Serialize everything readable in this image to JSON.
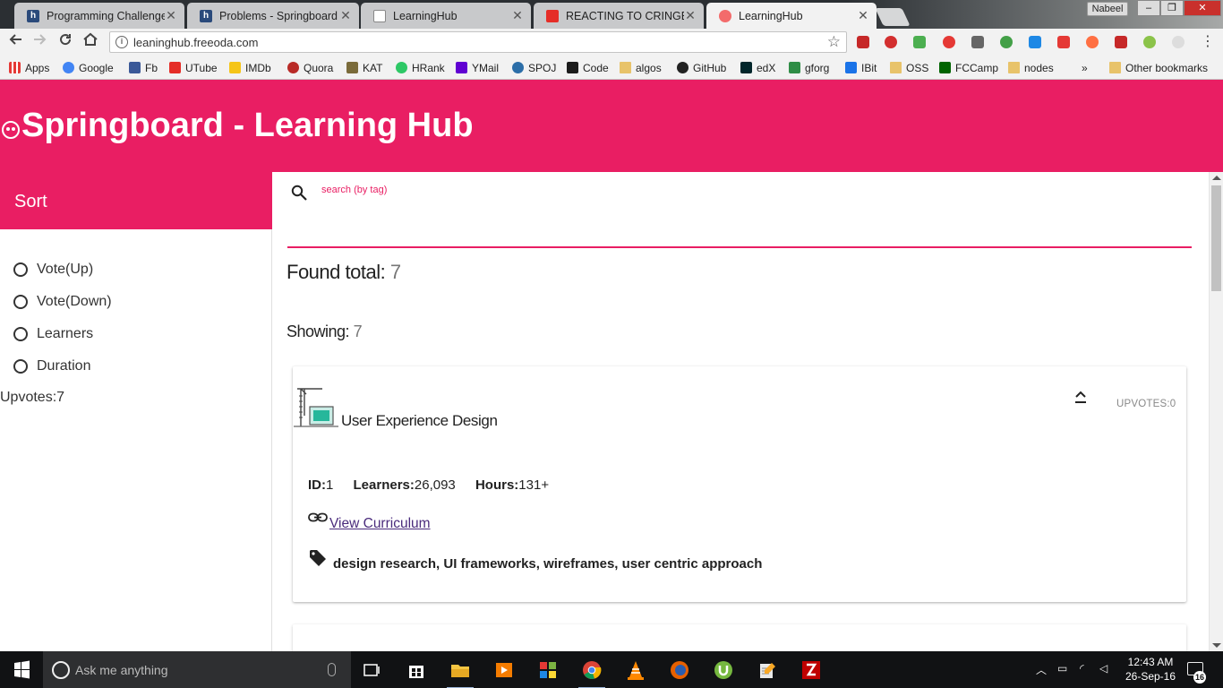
{
  "browser": {
    "tabs": [
      {
        "title": "Programming Challenge",
        "favicon": "hackerrank-icon"
      },
      {
        "title": "Problems - Springboard",
        "favicon": "hackerrank-icon"
      },
      {
        "title": "LearningHub",
        "favicon": "document-icon"
      },
      {
        "title": "REACTING TO CRINGE /v",
        "favicon": "youtube-icon"
      },
      {
        "title": "LearningHub",
        "favicon": "learninghub-icon",
        "active": true
      }
    ],
    "window_user": "Nabeel",
    "window_controls": {
      "minimize": "‒",
      "maximize": "❐",
      "close": "✕"
    },
    "address": "leaninghub.freeoda.com",
    "bookmarks": [
      {
        "label": "Apps",
        "icon": "apps-grid-icon"
      },
      {
        "label": "Google",
        "icon": "google-icon"
      },
      {
        "label": "Fb",
        "icon": "facebook-icon"
      },
      {
        "label": "UTube",
        "icon": "youtube-icon"
      },
      {
        "label": "IMDb",
        "icon": "imdb-icon"
      },
      {
        "label": "Quora",
        "icon": "quora-icon"
      },
      {
        "label": "KAT",
        "icon": "kat-icon"
      },
      {
        "label": "HRank",
        "icon": "hackerrank-icon"
      },
      {
        "label": "YMail",
        "icon": "yahoo-mail-icon"
      },
      {
        "label": "SPOJ",
        "icon": "spoj-icon"
      },
      {
        "label": "Code",
        "icon": "code-icon"
      },
      {
        "label": "algos",
        "icon": "folder-icon"
      },
      {
        "label": "GitHub",
        "icon": "github-icon"
      },
      {
        "label": "edX",
        "icon": "edx-icon"
      },
      {
        "label": "gforg",
        "icon": "geeksforgeeks-icon"
      },
      {
        "label": "IBit",
        "icon": "interviewbit-icon"
      },
      {
        "label": "OSS",
        "icon": "folder-icon"
      },
      {
        "label": "FCCamp",
        "icon": "freecodecamp-icon"
      },
      {
        "label": "nodes",
        "icon": "folder-icon"
      }
    ],
    "bookmarks_overflow": "»",
    "other_bookmarks": "Other bookmarks"
  },
  "app": {
    "title": "Springboard - Learning Hub"
  },
  "sidebar": {
    "sort_title": "Sort",
    "options": [
      "Vote(Up)",
      "Vote(Down)",
      "Learners",
      "Duration"
    ],
    "upvotes": "Upvotes:7"
  },
  "search": {
    "placeholder": "search (by tag)"
  },
  "results": {
    "found_label": "Found total:",
    "found_value": "7",
    "showing_label": "Showing:",
    "showing_value": "7"
  },
  "courses": [
    {
      "title": "User Experience Design",
      "upvotes": "UPVOTES:0",
      "id_label": "ID:",
      "id": "1",
      "learners_label": "Learners:",
      "learners": "26,093",
      "hours_label": "Hours:",
      "hours": "131+",
      "link_text": "View Curriculum",
      "tags": "design research, UI frameworks, wireframes, user centric approach"
    }
  ],
  "taskbar": {
    "search_placeholder": "Ask me anything",
    "time": "12:43 AM",
    "date": "26-Sep-16",
    "notifications": "16"
  },
  "colors": {
    "accent": "#e91e63",
    "link": "#4a2b7c"
  }
}
